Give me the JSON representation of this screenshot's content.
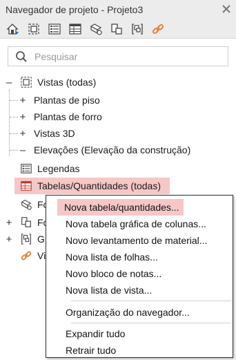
{
  "window": {
    "title": "Navegador de projeto - Projeto3"
  },
  "toolbar": {
    "buttons": [
      {
        "icon": "home-filter-icon"
      },
      {
        "icon": "view-icon"
      },
      {
        "icon": "legend-icon"
      },
      {
        "icon": "schedule-icon"
      },
      {
        "icon": "sheet-icon"
      },
      {
        "icon": "family-icon"
      },
      {
        "icon": "group-icon"
      },
      {
        "icon": "link-icon"
      }
    ]
  },
  "search": {
    "placeholder": "Pesquisar"
  },
  "tree": {
    "views": "Vistas (todas)",
    "floor_plans": "Plantas de piso",
    "ceiling_plans": "Plantas de forro",
    "views_3d": "Vistas 3D",
    "elevations": "Elevações (Elevação da construção)",
    "legends": "Legendas",
    "schedules": "Tabelas/Quantidades (todas)",
    "families_partial": "Fo",
    "sheets_partial": "Fo",
    "groups_partial": "G",
    "links_partial": "Vi"
  },
  "context_menu": {
    "items": [
      "Nova tabela/quantidades...",
      "Nova tabela gráfica de colunas...",
      "Novo levantamento de material...",
      "Nova lista de folhas...",
      "Novo bloco de notas...",
      "Nova lista de vista...",
      "Organização do navegador...",
      "Expandir tudo",
      "Retrair tudo"
    ]
  },
  "colors": {
    "selection": "#f6c7c7",
    "accent_orange": "#e8803a"
  }
}
